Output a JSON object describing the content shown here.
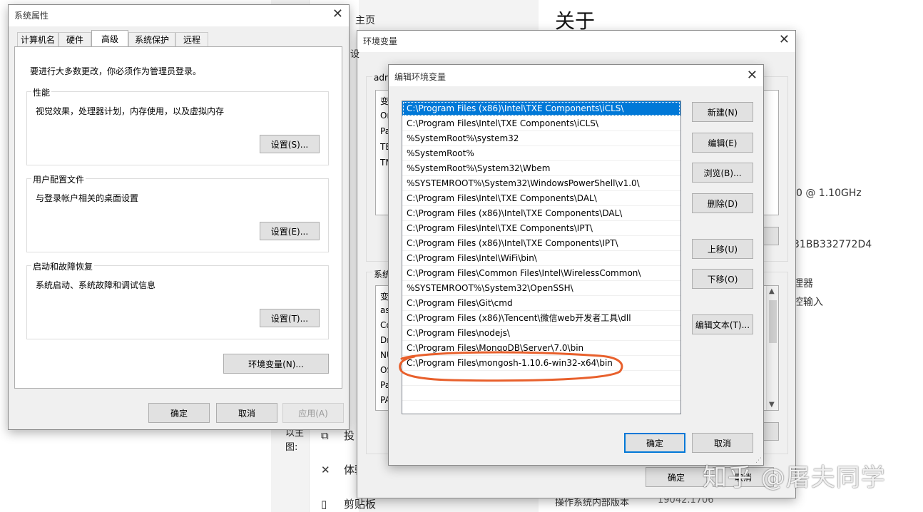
{
  "background": {
    "about_title": "关于",
    "cpu_freq": "0 @ 1.10GHz",
    "device_id_tail": "31BB332772D4",
    "processor_tail": "理器",
    "touch_tail": "控输入",
    "os_build_label": "操作系统内部版本",
    "os_build_value": "19042.1706",
    "top_tab_partial": "主页",
    "side_items": [
      {
        "icon": "cast-icon",
        "glyph": "⬚",
        "label": "投"
      },
      {
        "icon": "share-icon",
        "glyph": "✕",
        "label": "体验"
      },
      {
        "icon": "clipboard-icon",
        "glyph": "▯",
        "label": "剪贴板"
      }
    ],
    "left_cut_text": "图:",
    "left_cut_text2": "以主"
  },
  "sysprops": {
    "title": "系统属性",
    "tabs": [
      "计算机名",
      "硬件",
      "高级",
      "系统保护",
      "远程"
    ],
    "admin_note": "要进行大多数更改，你必须作为管理员登录。",
    "perf": {
      "label": "性能",
      "desc": "视觉效果，处理器计划，内存使用，以及虚拟内存",
      "button": "设置(S)..."
    },
    "profile": {
      "label": "用户配置文件",
      "desc": "与登录帐户相关的桌面设置",
      "button": "设置(E)..."
    },
    "startup": {
      "label": "启动和故障恢复",
      "desc": "系统启动、系统故障和调试信息",
      "button": "设置(T)..."
    },
    "env_button": "环境变量(N)...",
    "ok": "确定",
    "cancel": "取消",
    "apply": "应用(A)"
  },
  "envvars": {
    "title": "环境变量",
    "user_section_partial": "adm",
    "user_rows_partial": [
      "变",
      "On",
      "Pa",
      "TE",
      "TM"
    ],
    "system_section_partial": "系统",
    "system_rows_partial": [
      "变",
      "as",
      "Co",
      "Dr",
      "NU",
      "OS",
      "Pa",
      "PA"
    ],
    "ok": "确定",
    "cancel": "取消",
    "tab_partial": "设"
  },
  "edit": {
    "title": "编辑环境变量",
    "paths": [
      "C:\\Program Files (x86)\\Intel\\TXE Components\\iCLS\\",
      "C:\\Program Files\\Intel\\TXE Components\\iCLS\\",
      "%SystemRoot%\\system32",
      "%SystemRoot%",
      "%SystemRoot%\\System32\\Wbem",
      "%SYSTEMROOT%\\System32\\WindowsPowerShell\\v1.0\\",
      "C:\\Program Files\\Intel\\TXE Components\\DAL\\",
      "C:\\Program Files (x86)\\Intel\\TXE Components\\DAL\\",
      "C:\\Program Files\\Intel\\TXE Components\\IPT\\",
      "C:\\Program Files (x86)\\Intel\\TXE Components\\IPT\\",
      "C:\\Program Files\\Intel\\WiFi\\bin\\",
      "C:\\Program Files\\Common Files\\Intel\\WirelessCommon\\",
      "%SYSTEMROOT%\\System32\\OpenSSH\\",
      "C:\\Program Files\\Git\\cmd",
      "C:\\Program Files (x86)\\Tencent\\微信web开发者工具\\dll",
      "C:\\Program Files\\nodejs\\",
      "C:\\Program Files\\MongoDB\\Server\\7.0\\bin",
      "C:\\Program Files\\mongosh-1.10.6-win32-x64\\bin"
    ],
    "buttons": {
      "new": "新建(N)",
      "edit": "编辑(E)",
      "browse": "浏览(B)...",
      "delete": "删除(D)",
      "up": "上移(U)",
      "down": "下移(O)",
      "edit_text": "编辑文本(T)..."
    },
    "ok": "确定",
    "cancel": "取消",
    "highlight_color": "#e8602c"
  },
  "watermark": "知乎 @屠夫同学"
}
